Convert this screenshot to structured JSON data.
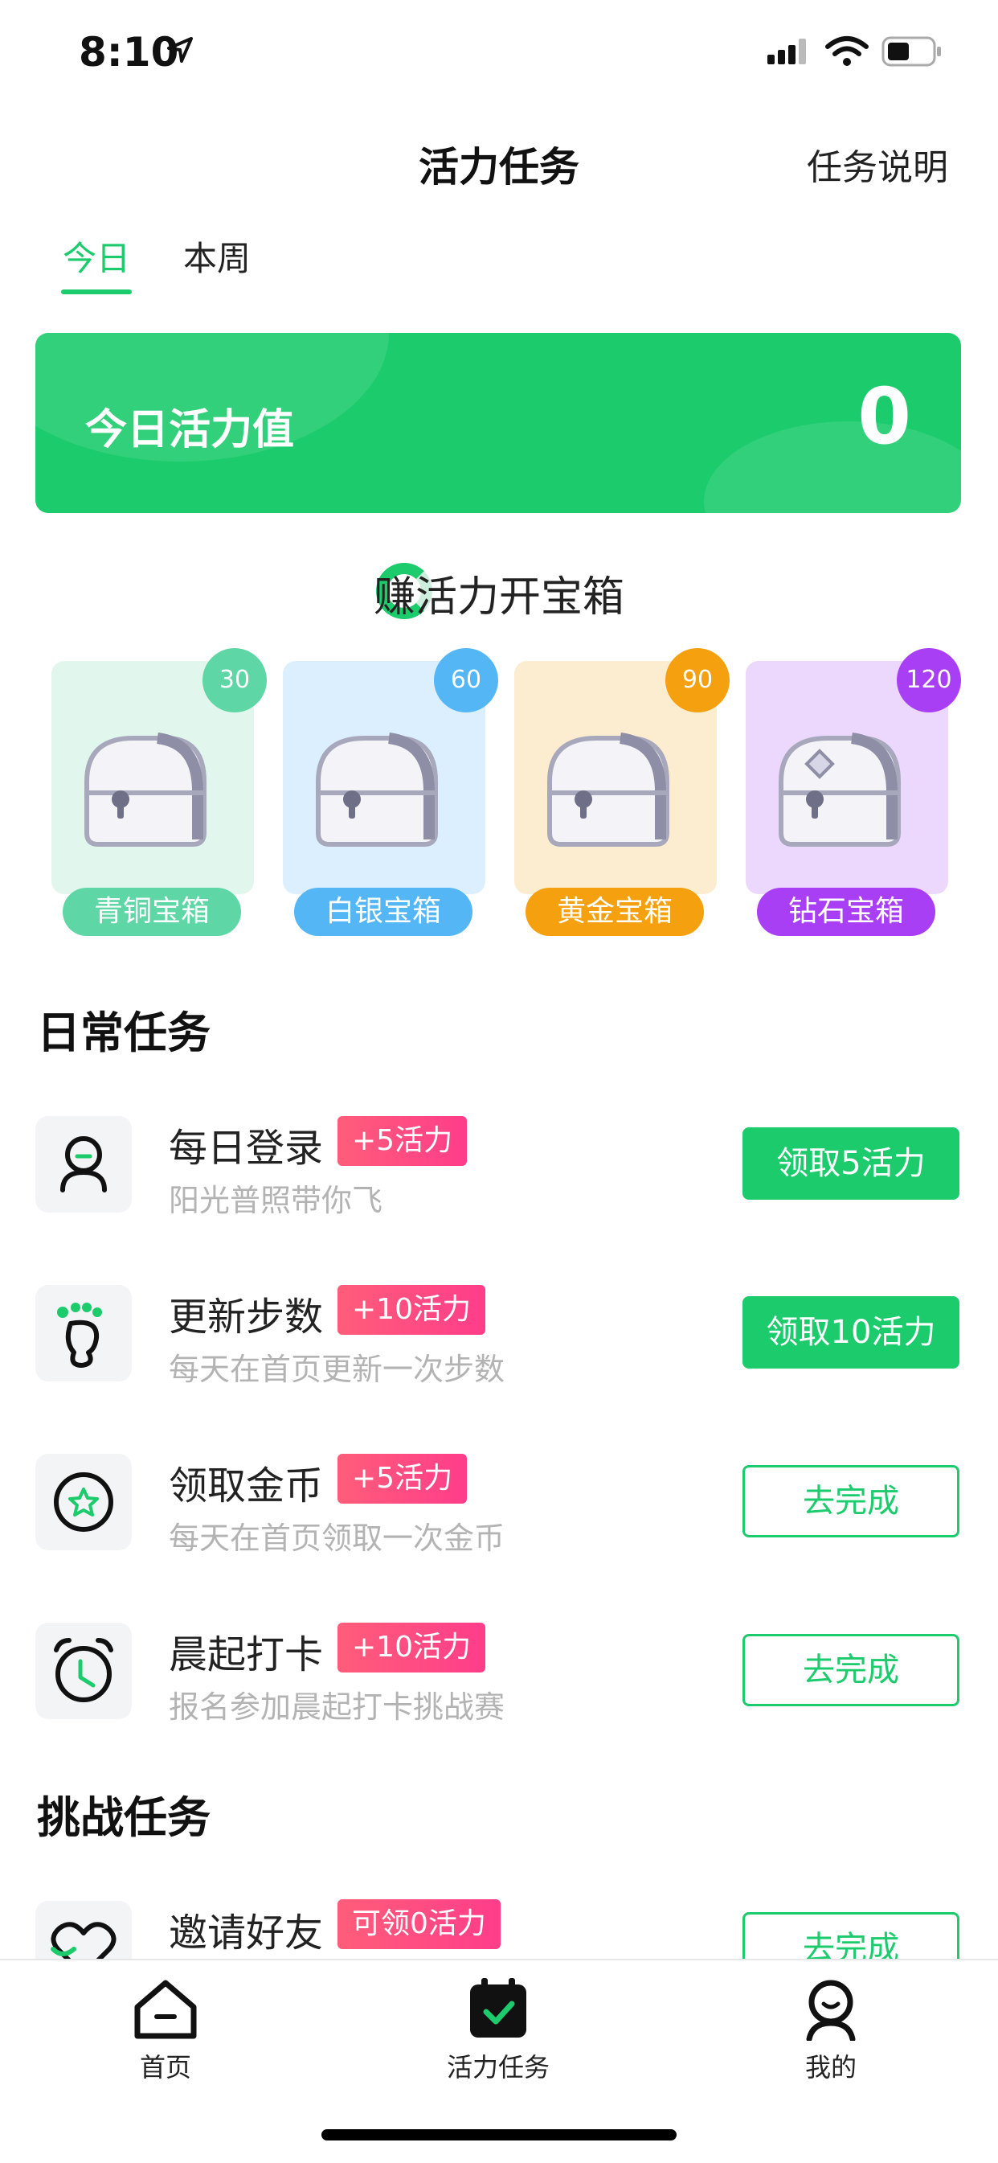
{
  "status_bar": {
    "time": "8:10"
  },
  "nav": {
    "title": "活力任务",
    "right_link": "任务说明"
  },
  "tabs": [
    {
      "label": "今日",
      "active": true
    },
    {
      "label": "本周",
      "active": false
    }
  ],
  "banner": {
    "label": "今日活力值",
    "value": "0",
    "color": "#1ccb6c"
  },
  "chests_section": {
    "title": "赚活力开宝箱"
  },
  "chests": [
    {
      "badge": "30",
      "label": "青铜宝箱",
      "card_bg": "#e1f6ec",
      "accent": "#5fd6a5"
    },
    {
      "badge": "60",
      "label": "白银宝箱",
      "card_bg": "#dcefff",
      "accent": "#55b6f6"
    },
    {
      "badge": "90",
      "label": "黄金宝箱",
      "card_bg": "#fcecd0",
      "accent": "#f5a00e"
    },
    {
      "badge": "120",
      "label": "钻石宝箱",
      "card_bg": "#ecd8fd",
      "accent": "#a93ff5"
    }
  ],
  "daily_section": {
    "title": "日常任务"
  },
  "daily_tasks": [
    {
      "title": "每日登录",
      "tag": "+5活力",
      "desc": "阳光普照带你飞",
      "button": "领取5活力",
      "button_style": "filled",
      "icon": "person-icon"
    },
    {
      "title": "更新步数",
      "tag": "+10活力",
      "desc": "每天在首页更新一次步数",
      "button": "领取10活力",
      "button_style": "filled",
      "icon": "footprint-icon"
    },
    {
      "title": "领取金币",
      "tag": "+5活力",
      "desc": "每天在首页领取一次金币",
      "button": "去完成",
      "button_style": "outline",
      "icon": "coin-star-icon"
    },
    {
      "title": "晨起打卡",
      "tag": "+10活力",
      "desc": "报名参加晨起打卡挑战赛",
      "button": "去完成",
      "button_style": "outline",
      "icon": "alarm-clock-icon"
    }
  ],
  "challenge_section": {
    "title": "挑战任务"
  },
  "challenge_tasks": [
    {
      "title": "邀请好友",
      "tag": "可领0活力",
      "button": "去完成",
      "button_style": "outline",
      "icon": "heart-icon"
    }
  ],
  "tabbar": [
    {
      "label": "首页",
      "icon": "home-icon",
      "active": false
    },
    {
      "label": "活力任务",
      "icon": "calendar-check-icon",
      "active": true
    },
    {
      "label": "我的",
      "icon": "profile-icon",
      "active": false
    }
  ]
}
